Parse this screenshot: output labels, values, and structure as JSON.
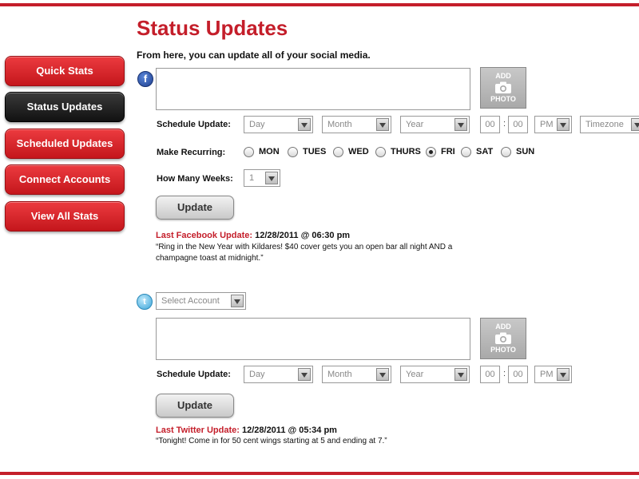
{
  "page": {
    "title": "Status Updates",
    "subtitle": "From here, you can update all of your social media."
  },
  "nav": {
    "items": [
      {
        "label": "Quick Stats"
      },
      {
        "label": "Status Updates"
      },
      {
        "label": "Scheduled Updates"
      },
      {
        "label": "Connect Accounts"
      },
      {
        "label": "View All Stats"
      }
    ]
  },
  "colors": {
    "accent": "#c41e2a",
    "active_nav": "#1a1a1a"
  },
  "icons": {
    "facebook": "f",
    "twitter": "t"
  },
  "facebook": {
    "photo_top": "ADD",
    "photo_bottom": "PHOTO",
    "schedule_label": "Schedule Update:",
    "day": "Day",
    "month": "Month",
    "year": "Year",
    "hour": "00",
    "minute": "00",
    "ampm": "PM",
    "timezone": "Timezone",
    "recurring_label": "Make Recurring:",
    "days": [
      {
        "label": "MON",
        "checked": false
      },
      {
        "label": "TUES",
        "checked": false
      },
      {
        "label": "WED",
        "checked": false
      },
      {
        "label": "THURS",
        "checked": false
      },
      {
        "label": "FRI",
        "checked": true
      },
      {
        "label": "SAT",
        "checked": false
      },
      {
        "label": "SUN",
        "checked": false
      }
    ],
    "weeks_label": "How Many Weeks:",
    "weeks": "1",
    "update_label": "Update",
    "last_label": "Last Facebook Update:",
    "last_time": "12/28/2011 @ 06:30 pm",
    "last_text_line1": "“Ring in the New Year with Kildares! $40 cover gets you an open bar all night AND a",
    "last_text_line2": "champagne toast at midnight.”"
  },
  "twitter": {
    "account_placeholder": "Select Account",
    "photo_top": "ADD",
    "photo_bottom": "PHOTO",
    "schedule_label": "Schedule Update:",
    "day": "Day",
    "month": "Month",
    "year": "Year",
    "hour": "00",
    "minute": "00",
    "ampm": "PM",
    "update_label": "Update",
    "last_label": "Last Twitter Update:",
    "last_time": "12/28/2011 @ 05:34 pm",
    "last_text": "“Tonight! Come in for 50 cent wings starting at 5 and ending at 7.”"
  }
}
